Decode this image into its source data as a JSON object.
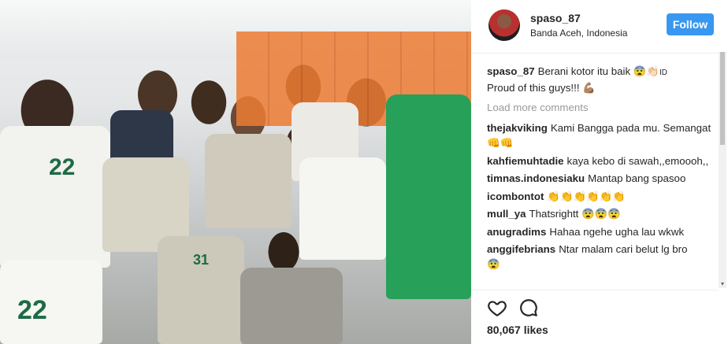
{
  "post": {
    "username": "spaso_87",
    "location": "Banda Aceh, Indonesia",
    "follow_label": "Follow",
    "caption_line1": "Berani kotor itu baik",
    "caption_emoji": "😨👏🏻",
    "caption_flag": "ID",
    "caption_line2": "Proud of this guys!!!",
    "caption_emoji2": "💪🏽",
    "load_more": "Load more comments",
    "likes": "80,067 likes"
  },
  "photo": {
    "jersey_numbers": [
      "22",
      "22",
      "31"
    ]
  },
  "comments": [
    {
      "user": "thejakviking",
      "text": "Kami Bangga pada mu. Semangat",
      "emoji": "👊👊"
    },
    {
      "user": "kahfiemuhtadie",
      "text": "kaya kebo di sawah,,emoooh,,",
      "emoji": ""
    },
    {
      "user": "timnas.indonesiaku",
      "text": "Mantap bang spasoo",
      "emoji": ""
    },
    {
      "user": "icombontot",
      "text": "",
      "emoji": "👏👏👏👏👏👏"
    },
    {
      "user": "mull_ya",
      "text": "Thatsrightt",
      "emoji": "😨😨😨"
    },
    {
      "user": "anugradims",
      "text": "Hahaa ngehe ugha lau wkwk",
      "emoji": ""
    },
    {
      "user": "anggifebrians",
      "text": "Ntar malam cari belut lg bro",
      "emoji": "😨"
    }
  ],
  "icons": {
    "like": "heart-icon",
    "comment": "comment-icon"
  },
  "colors": {
    "follow_button": "#3897f0",
    "muted_text": "#999999"
  }
}
